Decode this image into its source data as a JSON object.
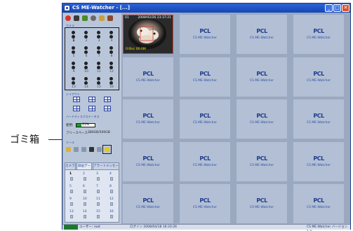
{
  "callout": {
    "label": "ゴミ箱"
  },
  "window": {
    "title": "CS ME-Watcher - [...]",
    "minimize": "_",
    "maximize": "□",
    "close": "✕"
  },
  "left_panel": {
    "sections": {
      "camera": "カメラ",
      "layout": "レイアウト",
      "hdd_status": "ハードディスクステータス",
      "tools": "ツール"
    },
    "camera_numbers": [
      "1",
      "2",
      "3",
      "4",
      "5",
      "6",
      "7",
      "8",
      "9",
      "10",
      "11",
      "12",
      "13",
      "14",
      "15",
      "16"
    ],
    "hdd": {
      "used_label": "使用:",
      "used_percent": "25%",
      "used_fraction": 0.25,
      "free_label": "フリースペース:",
      "free_value": "380GB/500GB"
    },
    "tabs": [
      "カメラ",
      "録画データ",
      "アラートメッセージ"
    ],
    "list_numbers": [
      "1",
      "2",
      "3",
      "4",
      "5",
      "6",
      "7",
      "8",
      "9",
      "10",
      "11",
      "12",
      "13",
      "14",
      "15",
      "16"
    ]
  },
  "grid": {
    "live_tile": {
      "channel": "01",
      "timestamp": "2008/02/26 23:37:21",
      "status": "0:0lsc 00:0M"
    },
    "placeholder_logo": "PCL",
    "placeholder_caption": "CS ME-Watcher"
  },
  "status_bar": {
    "user": "ユーザー: root",
    "login": "ログイン 2008/04/18 16:33:26",
    "app": "CS ME-Watcher  バージョン 1.0"
  },
  "colors": {
    "title_blue": "#1546b3",
    "hdd_green": "#14a02a",
    "live_border": "#d04030",
    "panel": "#b9c6da"
  }
}
